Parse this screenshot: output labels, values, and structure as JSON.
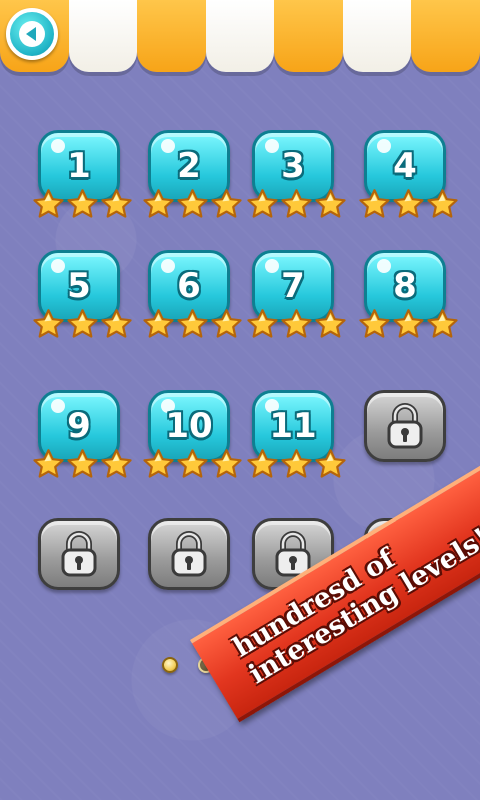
{
  "header": {
    "back_icon": "back-arrow-icon",
    "awning_colors": [
      "#f7a418",
      "#ffffff"
    ]
  },
  "levels": [
    {
      "label": "1",
      "locked": false,
      "stars": 3
    },
    {
      "label": "2",
      "locked": false,
      "stars": 3
    },
    {
      "label": "3",
      "locked": false,
      "stars": 3
    },
    {
      "label": "4",
      "locked": false,
      "stars": 3
    },
    {
      "label": "5",
      "locked": false,
      "stars": 3
    },
    {
      "label": "6",
      "locked": false,
      "stars": 3
    },
    {
      "label": "7",
      "locked": false,
      "stars": 3
    },
    {
      "label": "8",
      "locked": false,
      "stars": 3
    },
    {
      "label": "9",
      "locked": false,
      "stars": 3
    },
    {
      "label": "10",
      "locked": false,
      "stars": 3
    },
    {
      "label": "11",
      "locked": false,
      "stars": 3
    },
    {
      "label": "",
      "locked": true,
      "stars": 0
    },
    {
      "label": "",
      "locked": true,
      "stars": 0
    },
    {
      "label": "",
      "locked": true,
      "stars": 0
    },
    {
      "label": "",
      "locked": true,
      "stars": 0
    },
    {
      "label": "",
      "locked": true,
      "stars": 0
    }
  ],
  "pagination": {
    "pages": 4,
    "current": 1
  },
  "promo": {
    "line1": "hundresd of",
    "line2": "interesting levels!"
  },
  "colors": {
    "background": "#7f80be",
    "tile_unlocked": "#26c8dc",
    "tile_locked": "#9a9a9a",
    "star": "#ffc93a",
    "banner": "#e2361f"
  }
}
